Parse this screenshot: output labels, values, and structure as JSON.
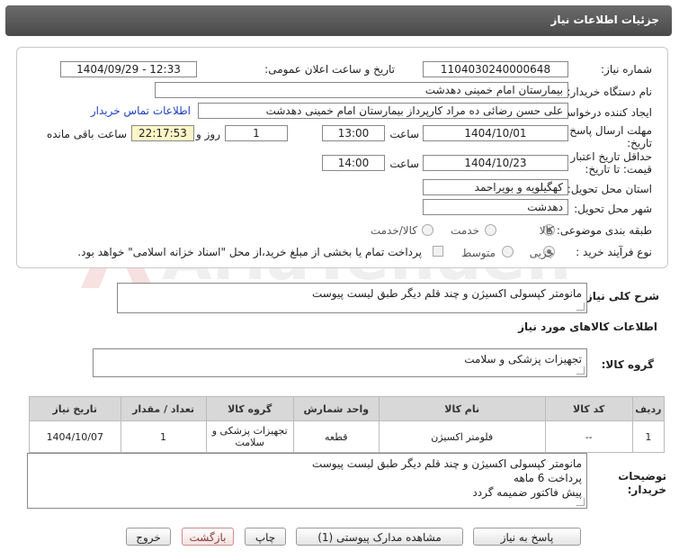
{
  "title": "جزئیات اطلاعات نیاز",
  "watermark_text": "AriaTender.net",
  "fields": {
    "need_number_label": "شماره نیاز:",
    "need_number": "1104030240000648",
    "announce_label": "تاریخ و ساعت اعلان عمومی:",
    "announce_value": "1404/09/29 - 12:33",
    "buyer_label": "نام دستگاه خریدار:",
    "buyer_value": "بیمارستان امام خمینی دهدشت",
    "creator_label": "ایجاد کننده درخواست:",
    "creator_value": "علی حسن رضائی ده مراد کارپرداز بیمارستان امام خمینی دهدشت",
    "contact_link": "اطلاعات تماس خریدار",
    "reply_deadline_label_1": "مهلت ارسال پاسخ: تا",
    "reply_deadline_label_2": "تاریخ:",
    "reply_date": "1404/10/01",
    "time_label": "ساعت",
    "reply_time": "13:00",
    "days_value": "1",
    "days_label": "روز و",
    "remaining_time": "22:17:53",
    "remaining_label": "ساعت باقی مانده",
    "validity_label_1": "حداقل تاریخ اعتبار",
    "validity_label_2": "قیمت: تا تاریخ:",
    "validity_date": "1404/10/23",
    "validity_time": "14:00",
    "province_label": "استان محل تحویل:",
    "province_value": "کهگیلویه و بویراحمد",
    "city_label": "شهر محل تحویل:",
    "city_value": "دهدشت",
    "category_label": "طبقه بندی موضوعی:",
    "category_options": [
      "کالا",
      "خدمت",
      "کالا/خدمت"
    ],
    "process_label": "نوع فرآیند خرید :",
    "process_options": [
      "جزیی",
      "متوسط"
    ],
    "payment_note": "پرداخت تمام یا بخشی از مبلغ خرید،از محل \"اسناد خزانه اسلامی\" خواهد بود."
  },
  "general_desc_label": "شرح کلی نیاز:",
  "general_desc": "مانومتر کپسولی اکسیژن و چند قلم دیگر طبق لیست پیوست",
  "goods_info_title": "اطلاعات کالاهای مورد نیاز",
  "goods_group_label": "گروه کالا:",
  "goods_group_value": "تجهیزات پزشکی و سلامت",
  "table": {
    "headers": [
      "ردیف",
      "کد کالا",
      "نام کالا",
      "واحد شمارش",
      "گروه کالا",
      "تعداد / مقدار",
      "تاریخ نیاز"
    ],
    "rows": [
      [
        "1",
        "--",
        "فلومتر اکسیژن",
        "قطعه",
        "تجهیزات پزشکی و سلامت",
        "1",
        "1404/10/07"
      ]
    ]
  },
  "buyer_notes_label_1": "توضیحات",
  "buyer_notes_label_2": "خریدار:",
  "buyer_notes_lines": [
    "مانومتر کپسولی اکسیژن و چند قلم دیگر طبق لیست پیوست",
    "پرداخت 6 ماهه",
    "پیش فاکتور ضمیمه گردد"
  ],
  "buttons": {
    "reply": "پاسخ به نیاز",
    "attachments": "مشاهده مدارک پیوستی (1)",
    "print": "چاپ",
    "back": "بازگشت",
    "exit": "خروج"
  }
}
